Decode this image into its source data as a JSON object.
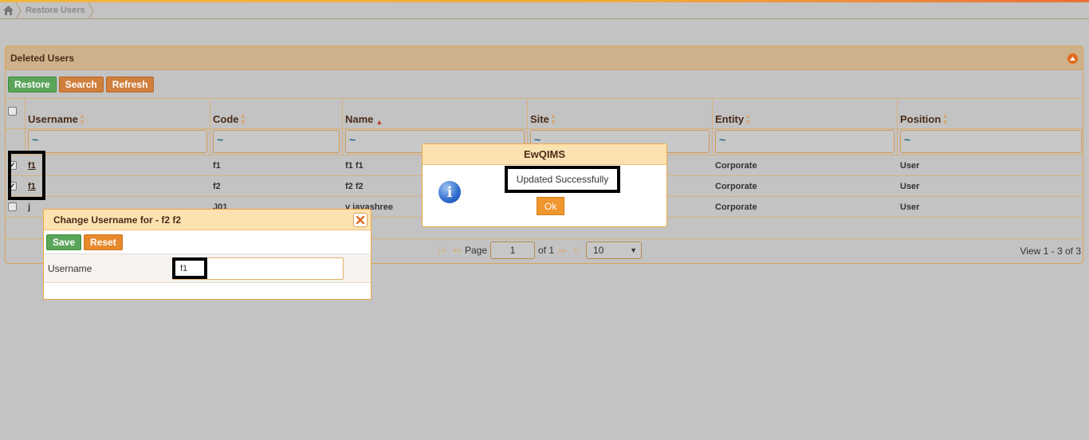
{
  "breadcrumb": {
    "current": "Restore Users"
  },
  "panel": {
    "title": "Deleted Users"
  },
  "toolbar": {
    "restore": "Restore",
    "search": "Search",
    "refresh": "Refresh"
  },
  "table": {
    "columns": [
      {
        "label": "Username"
      },
      {
        "label": "Code"
      },
      {
        "label": "Name"
      },
      {
        "label": "Site"
      },
      {
        "label": "Entity"
      },
      {
        "label": "Position"
      }
    ],
    "filter_value": "~",
    "rows": [
      {
        "checked": true,
        "username": "f1",
        "code": "f1",
        "name": "f1 f1",
        "site": "",
        "entity": "Corporate",
        "position": "User"
      },
      {
        "checked": true,
        "username": "f1",
        "code": "f2",
        "name": "f2 f2",
        "site": "",
        "entity": "Corporate",
        "position": "User"
      },
      {
        "checked": false,
        "username": "j",
        "code": "J01",
        "name": "v jayashree",
        "site": "",
        "entity": "Corporate",
        "position": "User"
      }
    ]
  },
  "pager": {
    "page_label": "Page",
    "page": "1",
    "of_label": "of 1",
    "rows_per_page": "10",
    "view_info": "View 1 - 3 of 3"
  },
  "change_dialog": {
    "title": "Change Username for - f2 f2",
    "save": "Save",
    "reset": "Reset",
    "field_label": "Username",
    "field_value": "f1"
  },
  "message_dialog": {
    "title": "EwQIMS",
    "message": "Updated Successfully",
    "ok": "Ok"
  },
  "colors": {
    "panel_header": "#cdb18a",
    "dialog_header": "#fde2b1",
    "green": "#5aa55a",
    "orange": "#e7892d"
  }
}
